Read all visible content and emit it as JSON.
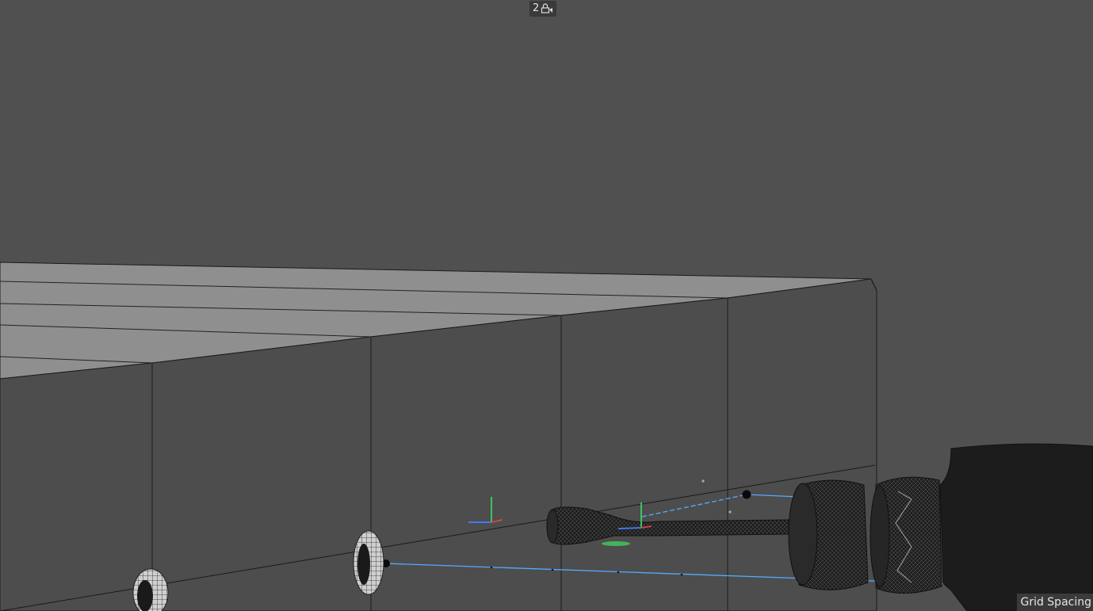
{
  "viewport": {
    "camera_indicator": {
      "number": "2",
      "icon": "camera-lock-icon"
    },
    "grid_spacing_label": "Grid Spacing"
  },
  "colors": {
    "background": "#505050",
    "floor_top": "#8f8f8f",
    "wall": "#4d4d4d",
    "edges": "#1a1a1a",
    "guide_line": "#55aaff",
    "axis_x": "#e04040",
    "axis_y": "#40d060",
    "axis_z": "#4080ff",
    "mesh_dark": "#1e1e1e"
  }
}
